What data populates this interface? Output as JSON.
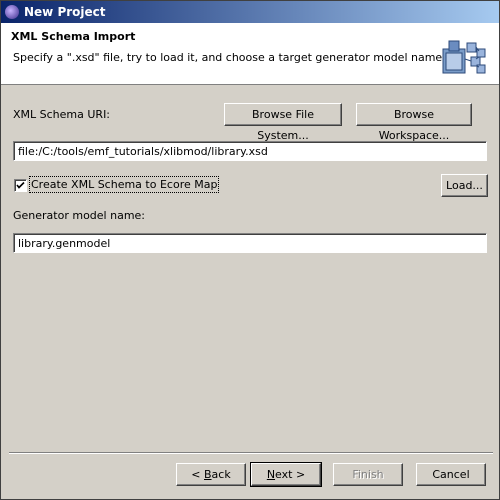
{
  "window": {
    "title": "New Project"
  },
  "header": {
    "title": "XML Schema Import",
    "description": "Specify a \".xsd\" file, try to load it, and choose a target generator model name"
  },
  "schema": {
    "label": "XML Schema URI:",
    "browse_fs_label": "Browse File System...",
    "browse_ws_label": "Browse Workspace...",
    "uri_value": "file:/C:/tools/emf_tutorials/xlibmod/library.xsd"
  },
  "options": {
    "create_map_label": "Create XML Schema to Ecore Map",
    "create_map_checked": true,
    "load_label": "Load..."
  },
  "generator": {
    "label": "Generator model name:",
    "value": "library.genmodel"
  },
  "footer": {
    "back": {
      "prefix": "< ",
      "mnemonic": "B",
      "rest": "ack"
    },
    "next": {
      "mnemonic": "N",
      "rest": "ext >"
    },
    "finish_label": "Finish",
    "cancel_label": "Cancel"
  }
}
